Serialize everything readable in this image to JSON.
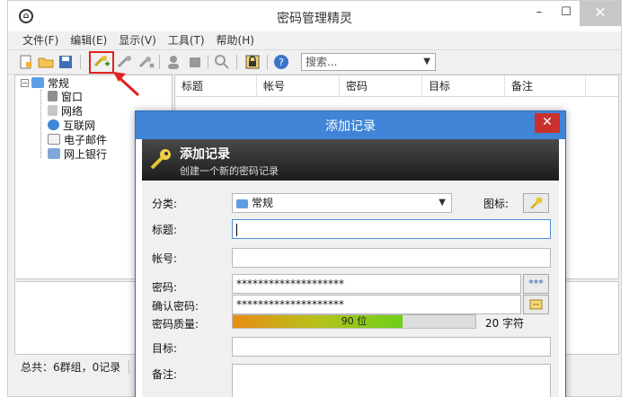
{
  "window": {
    "title": "密码管理精灵",
    "minimize": "–",
    "maximize": "☐",
    "close": "✕"
  },
  "menu": [
    "文件(F)",
    "编辑(E)",
    "显示(V)",
    "工具(T)",
    "帮助(H)"
  ],
  "toolbar": {
    "search_value": "搜索..."
  },
  "tree": {
    "root": "常规",
    "toggle": "−",
    "children": [
      "窗口",
      "网络",
      "互联网",
      "电子邮件",
      "网上银行"
    ]
  },
  "list": {
    "columns": [
      "标题",
      "帐号",
      "密码",
      "目标",
      "备注"
    ]
  },
  "status": {
    "text": "总共：6群组，0记录"
  },
  "dialog": {
    "title": "添加记录",
    "close": "✕",
    "header_title": "添加记录",
    "header_subtitle": "创建一个新的密码记录",
    "labels": {
      "category": "分类:",
      "icon": "图标:",
      "title": "标题:",
      "account": "帐号:",
      "password": "密码:",
      "confirm": "确认密码:",
      "quality": "密码质量:",
      "target": "目标:",
      "notes": "备注:"
    },
    "category_value": "常规",
    "password_value": "********************",
    "confirm_value": "********************",
    "show_password_button": "***",
    "quality_percent": 70,
    "quality_text": "90 位",
    "quality_chars": "20 字符"
  },
  "colors": {
    "dialog_titlebar": "#3f84d6",
    "close_button": "#c9312f",
    "highlight": "#e12020"
  }
}
